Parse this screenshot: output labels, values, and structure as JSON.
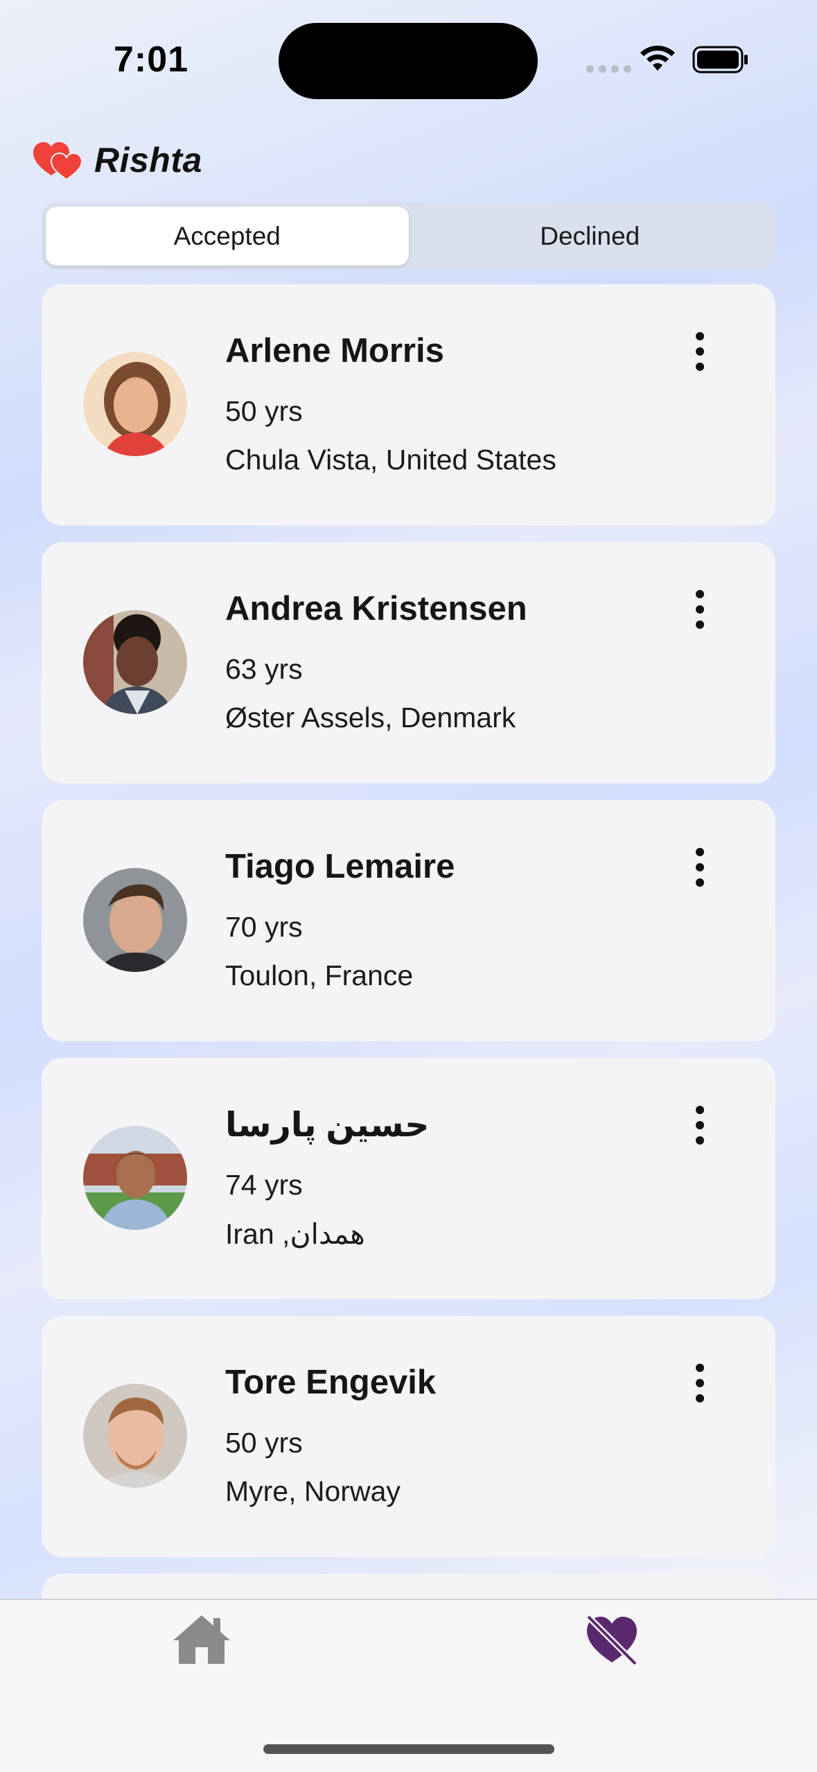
{
  "status_bar": {
    "time": "7:01",
    "icons": [
      "cellular-signal-icon",
      "wifi-icon",
      "battery-icon"
    ]
  },
  "app": {
    "title": "Rishta",
    "logo_icon": "double-heart-icon",
    "logo_color": "#f0413a"
  },
  "tabs": {
    "accepted_label": "Accepted",
    "declined_label": "Declined",
    "selected": "Accepted"
  },
  "profiles": [
    {
      "name": "Arlene Morris",
      "age": "50 yrs",
      "location": "Chula Vista, United States",
      "avatar_icon": "avatar-photo"
    },
    {
      "name": "Andrea Kristensen",
      "age": "63 yrs",
      "location": "Øster Assels, Denmark",
      "avatar_icon": "avatar-photo"
    },
    {
      "name": "Tiago Lemaire",
      "age": "70 yrs",
      "location": "Toulon, France",
      "avatar_icon": "avatar-photo"
    },
    {
      "name": "حسین پارسا",
      "age": "74 yrs",
      "location": "Iran ,همدان",
      "avatar_icon": "avatar-photo"
    },
    {
      "name": "Tore Engevik",
      "age": "50 yrs",
      "location": "Myre, Norway",
      "avatar_icon": "avatar-photo"
    }
  ],
  "bottom_nav": {
    "items": [
      {
        "icon": "home-icon",
        "color": "#8a8a8a"
      },
      {
        "icon": "heart-slash-icon",
        "color": "#5b2a6e",
        "active": true
      }
    ]
  }
}
